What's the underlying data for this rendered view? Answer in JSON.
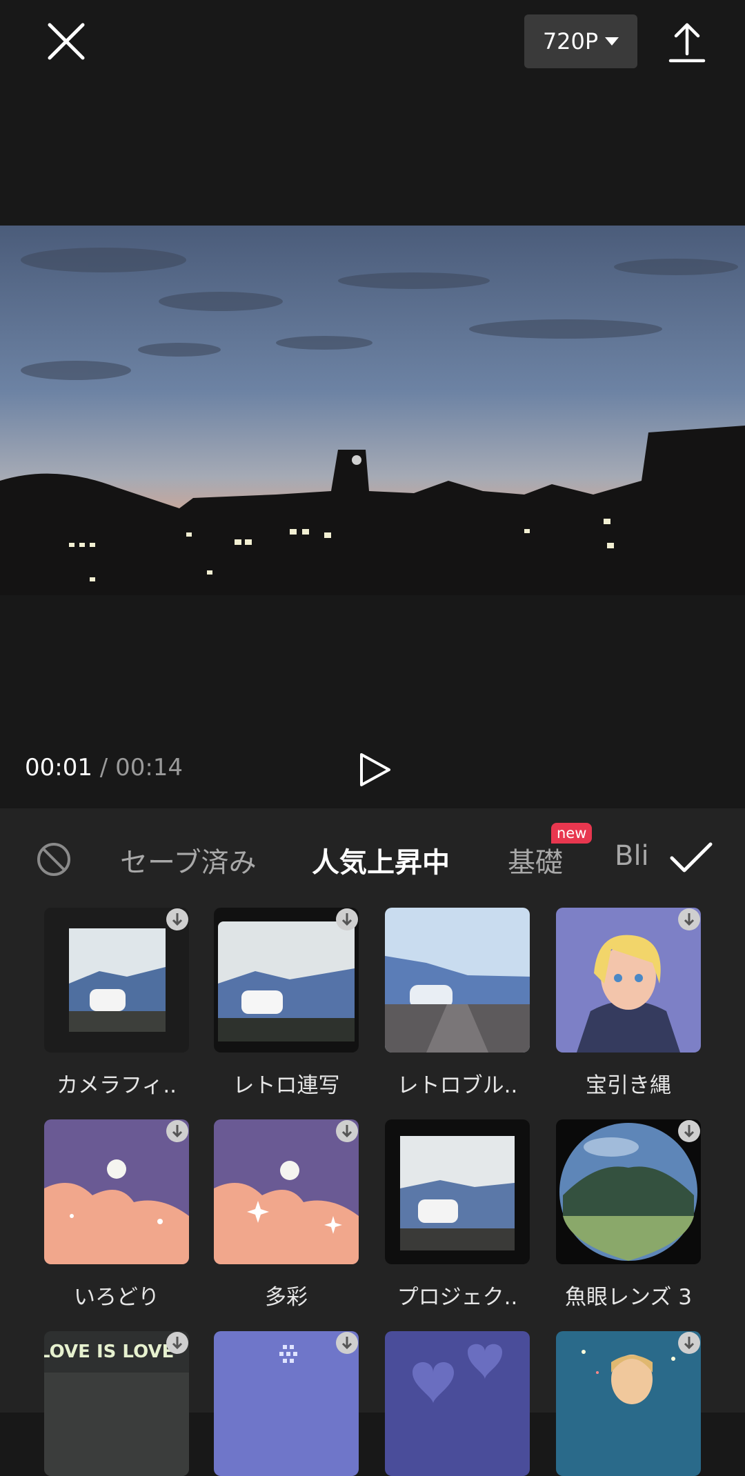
{
  "header": {
    "resolution": "720P",
    "close_icon": "close-icon",
    "export_icon": "upload-icon"
  },
  "player": {
    "current_time": "00:01",
    "separator": "/",
    "total_time": "00:14",
    "play_icon": "play-icon"
  },
  "filter_panel": {
    "none_icon": "no-effect-icon",
    "tabs": [
      {
        "label": "セーブ済み"
      },
      {
        "label": "人気上昇中",
        "active": true
      },
      {
        "label": "基礎",
        "badge": "new"
      },
      {
        "label": "Blink"
      }
    ],
    "confirm_icon": "checkmark-icon",
    "items": [
      {
        "label": "カメラフィ.."
      },
      {
        "label": "レトロ連写"
      },
      {
        "label": "レトロブル.."
      },
      {
        "label": "宝引き縄"
      },
      {
        "label": "いろどり"
      },
      {
        "label": "多彩"
      },
      {
        "label": "プロジェク.."
      },
      {
        "label": "魚眼レンズ 3"
      },
      {
        "label": "",
        "thumb_text": "LOVE IS LOVE"
      },
      {
        "label": ""
      },
      {
        "label": ""
      },
      {
        "label": ""
      }
    ]
  },
  "colors": {
    "background": "#181818",
    "panel": "#232323",
    "badge": "#e8374f"
  }
}
